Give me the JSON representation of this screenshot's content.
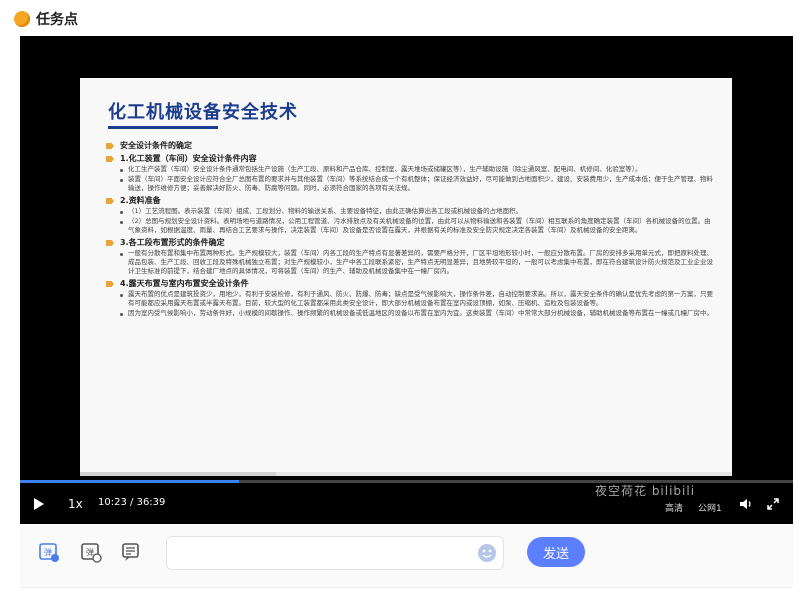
{
  "header": {
    "title": "任务点"
  },
  "slide": {
    "title": "化工机械设备安全技术",
    "sections": [
      {
        "heading": "安全设计条件的确定",
        "bullets": []
      },
      {
        "heading": "1.化工装置（车间）安全设计条件内容",
        "bullets": [
          "化工生产装置（车间）安全设计条件通常包括生产设施（生产工段、原料和产品仓库、控制室、露天堆场或储罐区等），生产辅助设施（除尘通风室、配电间、机修间、化验室等）。",
          "装置（车间）平面安全设计应符合全厂总图布置的要求并与其他装置（车间）等系统结合成一个有机整体；保证经济效益好，尽可能做到占地面积少，建设、安装费用少，生产成本低；便于生产管理、物料输送，操作维修方便；妥善解决好防火、防毒、防腐等问题。同时，必须符合国家的各项有关法规。"
        ]
      },
      {
        "heading": "2.资料准备",
        "bullets": [
          "（1）工艺流程图。表示装置（车间）组成、工段划分、物料的输送关系、主要设备特征，由此正确估算出各工段或机械设备的占地面积。",
          "（2）总图与规划安全设计资料。表明场地与道路情况，公用工程管道、污水排放点及有关机械设备的位置，由此可以从物料输送和各装置（车间）相互联系的角度确定装置（车间）各机械设备的位置。由气象资料，如根据温度、雨量、再结合工艺要求与操作，决定装置（车间）及设备是否设置在露天，并根据有关的标准及安全防灾规定决定各装置（车间）及机械设备的安全距离。"
        ]
      },
      {
        "heading": "3.各工段布置形式的条件确定",
        "bullets": [
          "一般有分散布置和集中布置两种形式。生产规模较大，装置（车间）内各工段的生产特点有显著差异的，需要严格分开，厂区平坦地形较小时，一般应分散布置。厂房的安排多采用单元式，即把原料处理、成品包装、生产工段、回收工段及特殊机械独立布置；对生产规模较小，生产中各工段联系紧密，生产特点无明显差异，且地势较平坦的，一般可以考虑集中布置，即在符合建筑设计防火规范及工业企业设计卫生标准的前提下，结合建厂地点的具体情况，可将装置（车间）的生产、辅助及机械设备集中在一幢厂房内。"
        ]
      },
      {
        "heading": "4.露天布置与室内布置安全设计条件",
        "bullets": [
          "露天布置的优点是建筑投资少，用地少，有利于安装检修，有利于通风、防火、防爆、防毒；缺点是受气候影响大，操作条件差，自动控制要求高。所以，露天安全条件的确认是优先考虑的第一方案，只要有可能都应采用露天布置或半露天布置。目前，较大型的化工装置都采用此类安全设计，即大部分机械设备布置在室内或设顶棚，如泵、压缩机、造粒及包装设备等。",
          "因为室内受气候影响小，劳动条件好，小规模的间歇操作、操作频繁的机械设备或低温地区的设备以布置在室内为宜。这类装置（车间）中常常大部分机械设备，辅助机械设备等布置在一幢或几幢厂房中。"
        ]
      }
    ]
  },
  "watermark": {
    "text": "夜空荷花 bilibili"
  },
  "controls": {
    "speed": "1x",
    "current_time": "10:23",
    "separator": "/",
    "duration": "36:39",
    "quality": "高清",
    "line": "公网1",
    "progress": 0.283
  },
  "toolbar": {
    "comment_placeholder": "",
    "send_label": "发送"
  },
  "colors": {
    "accent": "#5b7fff",
    "title_blue": "#1d3d8f",
    "marker": "#e8a53a"
  }
}
